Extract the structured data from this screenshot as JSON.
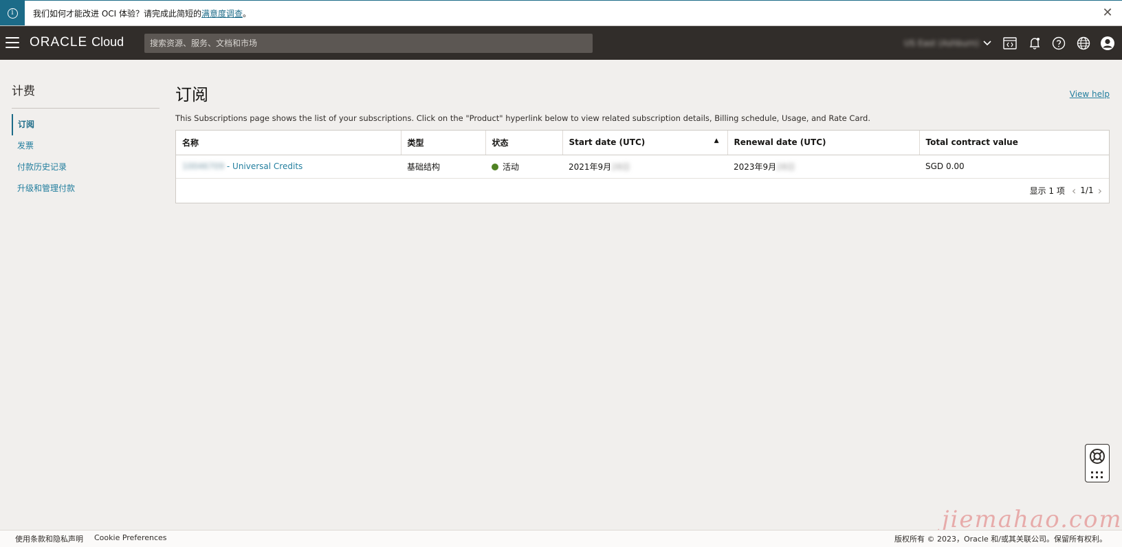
{
  "banner": {
    "info_icon": "info-icon",
    "text": "我们如何才能改进 OCI 体验？请完成此简短的",
    "link": "满意度调查",
    "suffix": "。"
  },
  "header": {
    "brand_main": "ORACLE",
    "brand_sub": "Cloud",
    "search_placeholder": "搜索资源、服务、文档和市场",
    "region_label": "US East (Ashburn)"
  },
  "sidebar": {
    "title": "计费",
    "items": [
      {
        "label": "订阅",
        "active": true
      },
      {
        "label": "发票",
        "active": false
      },
      {
        "label": "付款历史记录",
        "active": false
      },
      {
        "label": "升级和管理付款",
        "active": false
      }
    ]
  },
  "main": {
    "title": "订阅",
    "view_help": "View help",
    "description": "This Subscriptions page shows the list of your subscriptions. Click on the \"Product\" hyperlink below to view related subscription details, Billing schedule, Usage, and Rate Card.",
    "table": {
      "columns": [
        "名称",
        "类型",
        "状态",
        "Start date (UTC)",
        "Renewal date (UTC)",
        "Total contract value"
      ],
      "rows": [
        {
          "name_id": "10046709",
          "name": " - Universal Credits",
          "type": "基础结构",
          "status": "活动",
          "start_date": "2021年9月",
          "start_date_blur": "28日",
          "renewal_date": "2023年9月",
          "renewal_date_blur": "28日",
          "total": "SGD 0.00"
        }
      ],
      "pager_text": "显示 1 项",
      "page_indicator": "1/1"
    }
  },
  "watermark": "jiemahao.com",
  "footer": {
    "terms": "使用条款和隐私声明",
    "cookie": "Cookie Preferences",
    "copyright": "版权所有 © 2023，Oracle 和/或其关联公司。保留所有权利。"
  },
  "colors": {
    "header_bg": "#312d2a",
    "link": "#227e9e",
    "status_active": "#508223",
    "banner_accent": "#1c6b88"
  }
}
